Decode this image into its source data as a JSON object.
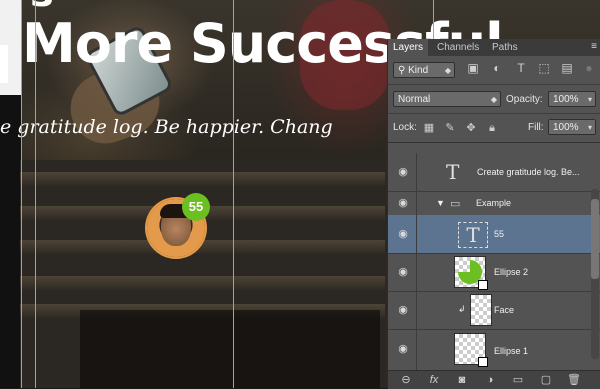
{
  "canvas": {
    "headline": "More Successful",
    "tagline": "e gratitude log. Be happier. Chang",
    "badge": "55"
  },
  "panel": {
    "tabs": [
      "Layers",
      "Channels",
      "Paths"
    ],
    "filter": {
      "kind_label": "Kind"
    },
    "blend": {
      "mode": "Normal",
      "opacity_label": "Opacity:",
      "opacity_value": "100%"
    },
    "lock": {
      "label": "Lock:",
      "fill_label": "Fill:",
      "fill_value": "100%"
    },
    "layers": [
      {
        "name": "Create gratitude log. Be...",
        "type": "text"
      },
      {
        "name": "Example",
        "type": "group"
      },
      {
        "name": "55",
        "type": "text",
        "selected": true
      },
      {
        "name": "Ellipse 2",
        "type": "shape"
      },
      {
        "name": "Face",
        "type": "image"
      },
      {
        "name": "Ellipse 1",
        "type": "shape"
      }
    ]
  },
  "colors": {
    "guide": "#29d2e8",
    "badge_green": "#6bbf20",
    "selected_layer": "#5d7490"
  }
}
